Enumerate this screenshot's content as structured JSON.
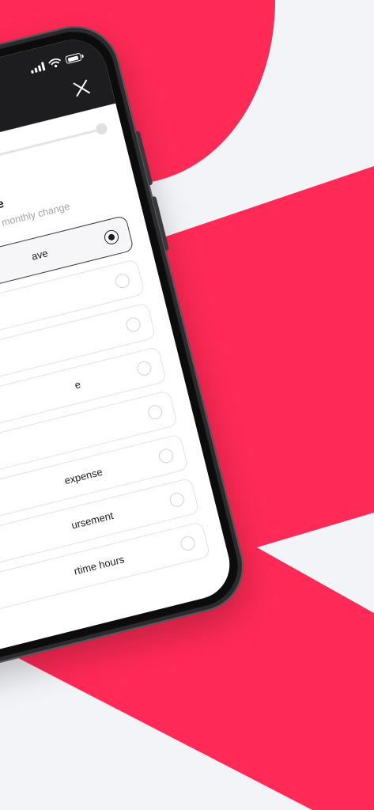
{
  "colors": {
    "brand_red": "#ff2a55",
    "page_background": "#f3f4f8",
    "header_dark": "#1d1d1f",
    "screen_white": "#ffffff"
  },
  "status_bar": {
    "icons": [
      "signal-icon",
      "wifi-icon",
      "battery-icon"
    ]
  },
  "header": {
    "close_icon": "close-icon"
  },
  "section": {
    "title": "ype",
    "subtitle": "monthly change"
  },
  "options": [
    {
      "label": "ave",
      "selected": true
    },
    {
      "label": "",
      "selected": false
    },
    {
      "label": "",
      "selected": false
    },
    {
      "label": "e",
      "selected": false
    },
    {
      "label": "",
      "selected": false
    },
    {
      "label": "expense",
      "selected": false
    },
    {
      "label": "ursement",
      "selected": false
    },
    {
      "label": "rtime hours",
      "selected": false
    }
  ]
}
